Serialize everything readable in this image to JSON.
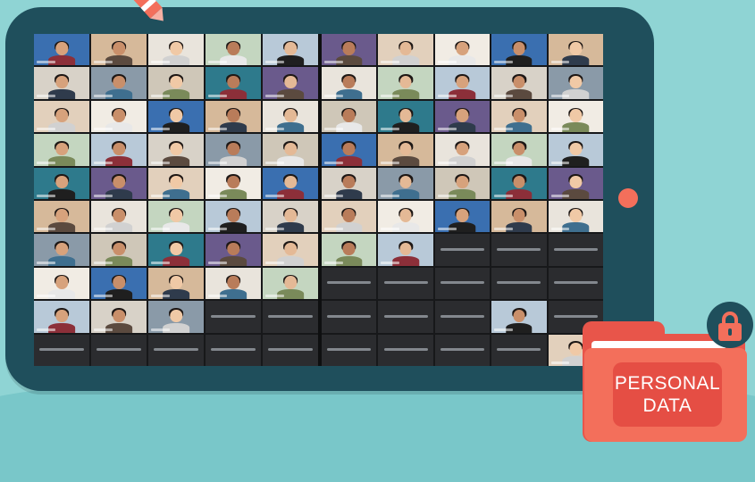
{
  "folder": {
    "label_line1": "PERSONAL",
    "label_line2": "DATA"
  },
  "icons": [
    "pen-icon",
    "lock-icon",
    "folder-icon"
  ],
  "colors": {
    "background": "#8fd4d4",
    "tablet": "#1f4f5c",
    "accent": "#f36f5b",
    "screen": "#202124"
  }
}
